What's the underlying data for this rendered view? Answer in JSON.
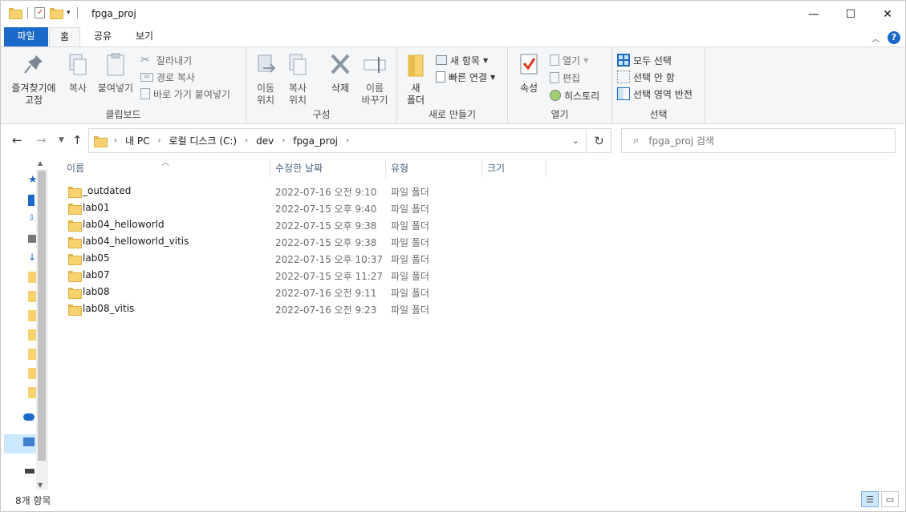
{
  "window": {
    "title": "fpga_proj"
  },
  "ribbon_tabs": [
    "파일",
    "홈",
    "공유",
    "보기"
  ],
  "ribbon": {
    "clipboard": {
      "label": "클립보드",
      "pin": "즐겨찾기에\n고정",
      "copy": "복사",
      "paste": "붙여넣기",
      "cut": "잘라내기",
      "copy_path": "경로 복사",
      "paste_shortcut": "바로 가기 붙여넣기"
    },
    "organize": {
      "label": "구성",
      "move_to": "이동\n위치",
      "copy_to": "복사\n위치",
      "delete": "삭제",
      "rename": "이름\n바꾸기"
    },
    "new": {
      "label": "새로 만들기",
      "new_folder": "새\n폴더",
      "new_item": "새 항목",
      "easy_access": "빠른 연결"
    },
    "open": {
      "label": "열기",
      "properties": "속성",
      "open": "열기",
      "edit": "편집",
      "history": "히스토리"
    },
    "select": {
      "label": "선택",
      "select_all": "모두 선택",
      "select_none": "선택 안 함",
      "invert": "선택 영역 반전"
    }
  },
  "address": {
    "crumbs": [
      "내 PC",
      "로컬 디스크 (C:)",
      "dev",
      "fpga_proj"
    ]
  },
  "search": {
    "placeholder": "fpga_proj 검색"
  },
  "columns": {
    "name": "이름",
    "date": "수정한 날짜",
    "type": "유형",
    "size": "크기"
  },
  "files": [
    {
      "name": "_outdated",
      "date": "2022-07-16 오전 9:10",
      "type": "파일 폴더"
    },
    {
      "name": "lab01",
      "date": "2022-07-15 오후 9:40",
      "type": "파일 폴더"
    },
    {
      "name": "lab04_helloworld",
      "date": "2022-07-15 오후 9:38",
      "type": "파일 폴더"
    },
    {
      "name": "lab04_helloworld_vitis",
      "date": "2022-07-15 오후 9:38",
      "type": "파일 폴더"
    },
    {
      "name": "lab05",
      "date": "2022-07-15 오후 10:37",
      "type": "파일 폴더"
    },
    {
      "name": "lab07",
      "date": "2022-07-15 오후 11:27",
      "type": "파일 폴더"
    },
    {
      "name": "lab08",
      "date": "2022-07-16 오전 9:11",
      "type": "파일 폴더"
    },
    {
      "name": "lab08_vitis",
      "date": "2022-07-16 오전 9:23",
      "type": "파일 폴더"
    }
  ],
  "status": {
    "count": "8개 항목"
  },
  "colors": {
    "accent": "#1b6ac9",
    "folder": "#f7d26e",
    "selection": "#cce8ff"
  }
}
